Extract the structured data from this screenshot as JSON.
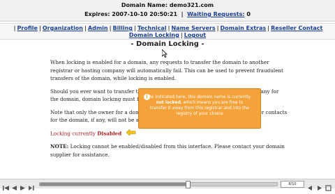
{
  "header": {
    "domain_label": "Domain Name:",
    "domain_value": "demo321.com",
    "expires_label": "Expires:",
    "expires_value": "2007-10-10 20:50:21",
    "waiting_label": "Waiting Requests:",
    "waiting_value": "0"
  },
  "nav": {
    "row1": [
      "Profile",
      "Organization",
      "Admin",
      "Billing",
      "Technical",
      "Name Servers",
      "Domain Extras",
      "Reseller Contact"
    ],
    "row2": [
      "Domain Locking",
      "Logout"
    ]
  },
  "page": {
    "title": "- Domain Locking -",
    "para1": "When locking is enabled for a domain, any requests to transfer the domain to another registrar or hosting company will automatically fail. This can be used to prevent fraudulent transfers of the domain, while locking is enabled.",
    "para2": "Should you ever want to transfer this domain to another registrar or hosting company for the domain, domain locking must first be disabled.",
    "para3": "Note that only the owner for a domain may enable or disable domain locking. Other contacts for the domain, if any, will not be able to perform this action.",
    "locking_label": "Locking currently",
    "locking_state": "Disabled",
    "note_label": "NOTE:",
    "note_text": "Locking cannot be enabled/disabled from this interface. Please contact your domain supplier for assistance."
  },
  "callout": {
    "icon": "info-icon",
    "text_before": "As indicated here, this domain name is currently",
    "text_bold": "not locked",
    "text_after": ", which means you are free to transfer it away from this registrar and into the registry of your choice"
  },
  "player": {
    "page_counter": "8/10",
    "progress": 0.62
  },
  "colors": {
    "link": "#1a3f9a",
    "callout": "#f4a33b",
    "disabled": "#b11a1a"
  }
}
